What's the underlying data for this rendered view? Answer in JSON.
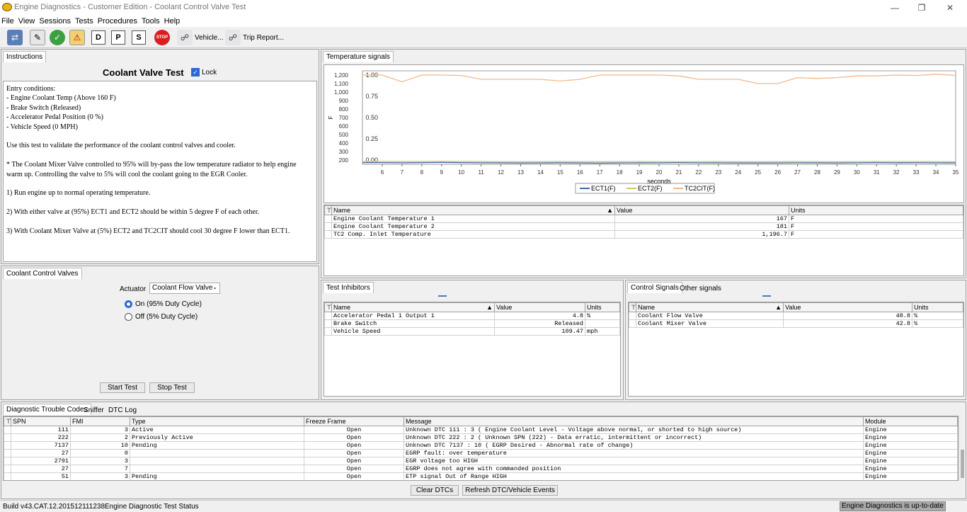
{
  "window": {
    "title": "Engine Diagnostics - Customer Edition - Coolant Control Valve Test"
  },
  "menu": [
    "File",
    "View",
    "Sessions",
    "Tests",
    "Procedures",
    "Tools",
    "Help"
  ],
  "toolbar": {
    "d_label": "D",
    "p_label": "P",
    "s_label": "S",
    "vehicle_label": "Vehicle...",
    "trip_label": "Trip Report..."
  },
  "instructions": {
    "tab": "Instructions",
    "title": "Coolant Valve Test",
    "lock_label": "Lock",
    "lines": [
      "Entry conditions:",
      "- Engine Coolant Temp (Above 160 F)",
      "- Brake Switch (Released)",
      "- Accelerator Pedal Position (0 %)",
      "- Vehicle Speed (0 MPH)",
      "",
      "Use this test to validate the performance of the coolant control valves and cooler.",
      "",
      "* The Coolant Mixer Valve controlled to 95% will by-pass the low temperature radiator to help engine",
      "warm up. Controlling the valve to 5% will cool the coolant going to the EGR Cooler.",
      "",
      "1) Run engine up to normal operating temperature.",
      "",
      "2) With either valve at (95%) ECT1 and ECT2 should be within 5 degree F of each other.",
      "",
      "3) With Coolant Mixer Valve at (5%) ECT2 and TC2CIT should cool 30 degree F lower than ECT1."
    ]
  },
  "control_valves": {
    "tab": "Coolant Control Valves",
    "actuator_label": "Actuator",
    "actuator_value": "Coolant Flow Valve",
    "radio_on": "On (95% Duty Cycle)",
    "radio_off": "Off (5% Duty Cycle)",
    "start_label": "Start Test",
    "stop_label": "Stop Test"
  },
  "temp_signals": {
    "tab": "Temperature signals",
    "columns": [
      "Name",
      "Value",
      "Units"
    ],
    "rows": [
      [
        "Engine Coolant Temperature 1",
        "167",
        "F"
      ],
      [
        "Engine Coolant Temperature 2",
        "181",
        "F"
      ],
      [
        "TC2 Comp. Inlet Temperature",
        "1,196.7",
        "F"
      ]
    ]
  },
  "chart_data": {
    "type": "line",
    "xlabel": "seconds",
    "ylabel": "F",
    "xlim": [
      5,
      35
    ],
    "x_ticks": [
      "6",
      "7",
      "8",
      "9",
      "10",
      "11",
      "12",
      "13",
      "14",
      "15",
      "16",
      "17",
      "18",
      "19",
      "20",
      "21",
      "22",
      "23",
      "24",
      "25",
      "26",
      "27",
      "28",
      "29",
      "30",
      "31",
      "32",
      "33",
      "34",
      "35"
    ],
    "y_left_ticks": [
      "200",
      "300",
      "400",
      "500",
      "600",
      "700",
      "800",
      "900",
      "1,000",
      "1,100",
      "1,200"
    ],
    "y_right_ticks": [
      "0.00",
      "0.25",
      "0.50",
      "0.75",
      "1.00"
    ],
    "ylim": [
      150,
      1250
    ],
    "x": [
      5,
      6,
      7,
      8,
      9,
      10,
      11,
      12,
      13,
      14,
      15,
      16,
      17,
      18,
      19,
      20,
      21,
      22,
      23,
      24,
      25,
      26,
      27,
      28,
      29,
      30,
      31,
      32,
      33,
      34,
      35
    ],
    "series": [
      {
        "name": "ECT1(F)",
        "color": "#3c6aa8",
        "values": [
          170,
          170,
          168,
          170,
          172,
          170,
          168,
          167,
          165,
          166,
          167,
          166,
          164,
          166,
          167,
          168,
          170,
          168,
          167,
          166,
          165,
          166,
          168,
          167,
          166,
          168,
          170,
          168,
          169,
          168,
          167
        ]
      },
      {
        "name": "ECT2(F)",
        "color": "#d6c26a",
        "values": [
          185,
          184,
          183,
          184,
          185,
          184,
          183,
          182,
          181,
          182,
          183,
          182,
          181,
          182,
          183,
          182,
          181,
          182,
          183,
          181,
          180,
          182,
          183,
          182,
          181,
          182,
          183,
          182,
          183,
          182,
          181
        ]
      },
      {
        "name": "TC2CIT(F)",
        "color": "#f2b88a",
        "values": [
          1200,
          1200,
          1120,
          1200,
          1200,
          1195,
          1150,
          1150,
          1150,
          1150,
          1130,
          1150,
          1200,
          1200,
          1200,
          1200,
          1190,
          1150,
          1150,
          1150,
          1100,
          1100,
          1170,
          1160,
          1170,
          1190,
          1190,
          1200,
          1195,
          1210,
          1196
        ]
      }
    ]
  },
  "inhibitors": {
    "tab": "Test Inhibitors",
    "columns": [
      "Name",
      "Value",
      "Units"
    ],
    "rows": [
      [
        "Accelerator Pedal 1 Output 1",
        "4.8",
        "%"
      ],
      [
        "Brake Switch",
        "Released",
        ""
      ],
      [
        "Vehicle Speed",
        "109.47",
        "mph"
      ]
    ]
  },
  "control_signals": {
    "tab": "Control Signals",
    "tab2": "Other signals",
    "columns": [
      "Name",
      "Value",
      "Units"
    ],
    "rows": [
      [
        "Coolant Flow Valve",
        "48.8",
        "%"
      ],
      [
        "Coolant Mixer Valve",
        "42.8",
        "%"
      ]
    ]
  },
  "dtc": {
    "tabs": [
      "Diagnostic Trouble Codes",
      "Sniffer",
      "DTC Log"
    ],
    "columns": [
      "SPN",
      "FMI",
      "Type",
      "Freeze Frame",
      "Message",
      "Module"
    ],
    "rows": [
      [
        "111",
        "3",
        "Active",
        "Open",
        "Unknown DTC 111 : 3  ( Engine Coolant Level - Voltage above normal, or shorted to high source)",
        "Engine"
      ],
      [
        "222",
        "2",
        "Previously Active",
        "Open",
        "Unknown DTC 222 : 2  ( Unknown SPN (222) - Data erratic, intermittent or incorrect)",
        "Engine"
      ],
      [
        "7137",
        "10",
        "Pending",
        "Open",
        "Unknown DTC 7137 : 10  ( EGRP Desired - Abnormal rate of change)",
        "Engine"
      ],
      [
        "27",
        "0",
        "",
        "Open",
        "EGRP fault: over temperature",
        "Engine"
      ],
      [
        "2791",
        "3",
        "",
        "Open",
        "EGR voltage too HIGH",
        "Engine"
      ],
      [
        "27",
        "7",
        "",
        "Open",
        "EGRP does not agree with commanded position",
        "Engine"
      ],
      [
        "51",
        "3",
        "Pending",
        "Open",
        "ETP signal Out of Range HIGH",
        "Engine"
      ]
    ],
    "clear_label": "Clear DTCs",
    "refresh_label": "Refresh DTC/Vehicle Events"
  },
  "status": {
    "build": "Build v43.CAT.12.201512111238",
    "test_status": "Engine Diagnostic Test Status",
    "update": "Engine Diagnostics is up-to-date"
  }
}
